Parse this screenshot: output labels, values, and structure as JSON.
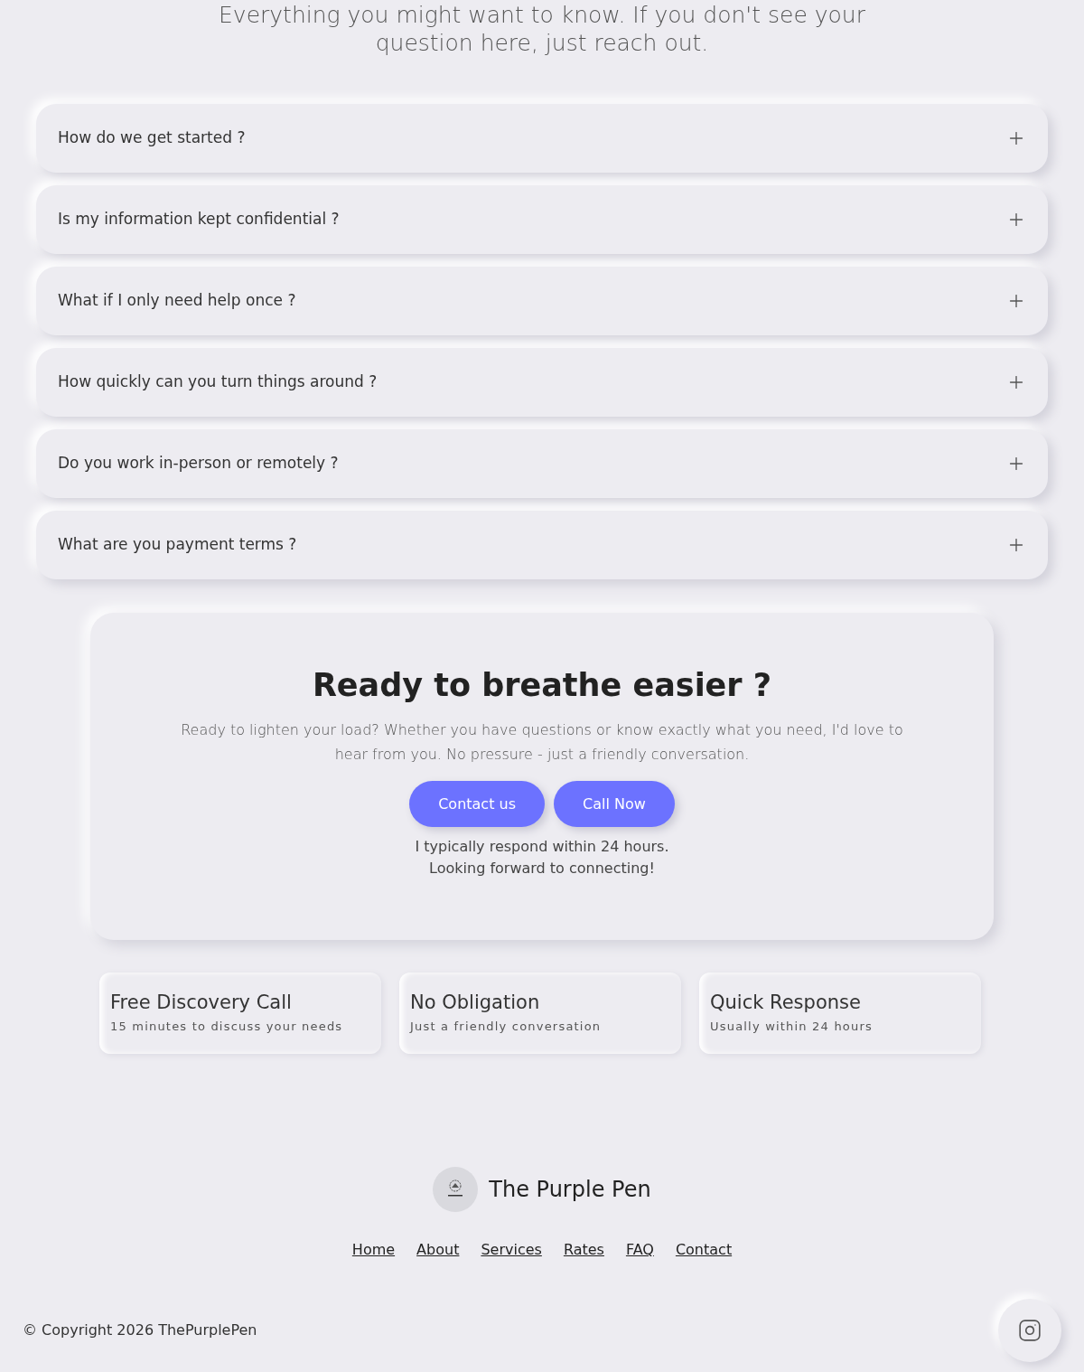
{
  "intro": "Everything you might want to know. If you don't see your question here, just reach out.",
  "faq": [
    {
      "question": "How do we get started ?",
      "expanded": false
    },
    {
      "question": "Is my information kept confidential ?",
      "expanded": false
    },
    {
      "question": "What if I only need help once ?",
      "expanded": false
    },
    {
      "question": "How quickly can you turn things around ?",
      "expanded": false
    },
    {
      "question": "Do you work in-person or remotely ?",
      "expanded": false
    },
    {
      "question": "What are you payment terms ?",
      "expanded": false
    }
  ],
  "cta": {
    "title": "Ready to breathe easier ?",
    "text": "Ready to lighten your load? Whether you have questions or know exactly what you need, I'd love to hear from you. No pressure - just a friendly conversation.",
    "buttons": [
      "Contact us",
      "Call Now"
    ],
    "note_lines": [
      "I typically respond within 24 hours.",
      "Looking forward to connecting!"
    ]
  },
  "features": [
    {
      "title": "Free Discovery Call",
      "subtitle": "15 minutes to discuss your needs"
    },
    {
      "title": "No Obligation",
      "subtitle": "Just a friendly conversation"
    },
    {
      "title": "Quick Response",
      "subtitle": "Usually within 24 hours"
    }
  ],
  "footer": {
    "brand": "The Purple Pen",
    "links": [
      "Home",
      "About",
      "Services",
      "Rates",
      "FAQ",
      "Contact"
    ],
    "copyright": "© Copyright 2026 ThePurplePen"
  }
}
